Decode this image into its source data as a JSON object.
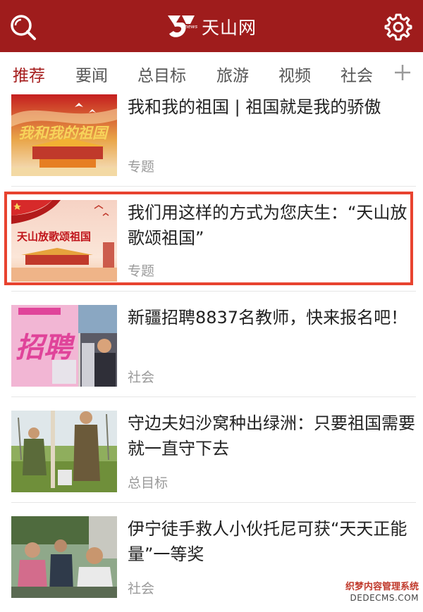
{
  "header": {
    "title": "天山网",
    "logo_text": "news",
    "bg_color": "#9f1c1c",
    "search_icon": "search-icon",
    "settings_icon": "gear-icon"
  },
  "tabs": [
    {
      "label": "推荐",
      "active": true
    },
    {
      "label": "要闻",
      "active": false
    },
    {
      "label": "总目标",
      "active": false
    },
    {
      "label": "旅游",
      "active": false
    },
    {
      "label": "视频",
      "active": false
    },
    {
      "label": "社会",
      "active": false
    }
  ],
  "tab_add_icon": "plus-icon",
  "articles": [
    {
      "title": "我和我的祖国 | 祖国就是我的骄傲",
      "tag": "专题",
      "thumb_text": "我和我的祖国"
    },
    {
      "title": "我们用这样的方式为您庆生：“天山放歌颂祖国”",
      "tag": "专题",
      "thumb_text": "天山放歌颂祖国",
      "highlighted": true
    },
    {
      "title": "新疆招聘8837名教师，快来报名吧！",
      "tag": "社会",
      "thumb_text": "招聘"
    },
    {
      "title": "守边夫妇沙窝种出绿洲：只要祖国需要就一直守下去",
      "tag": "总目标"
    },
    {
      "title": "伊宁徒手救人小伙托尼可获“天天正能量”一等奖",
      "tag": "社会"
    }
  ],
  "highlight_color": "#e8432f",
  "accent_color": "#a51d1d",
  "watermark": {
    "line1": "织梦内容管理系统",
    "line2": "DEDECMS.COM"
  }
}
